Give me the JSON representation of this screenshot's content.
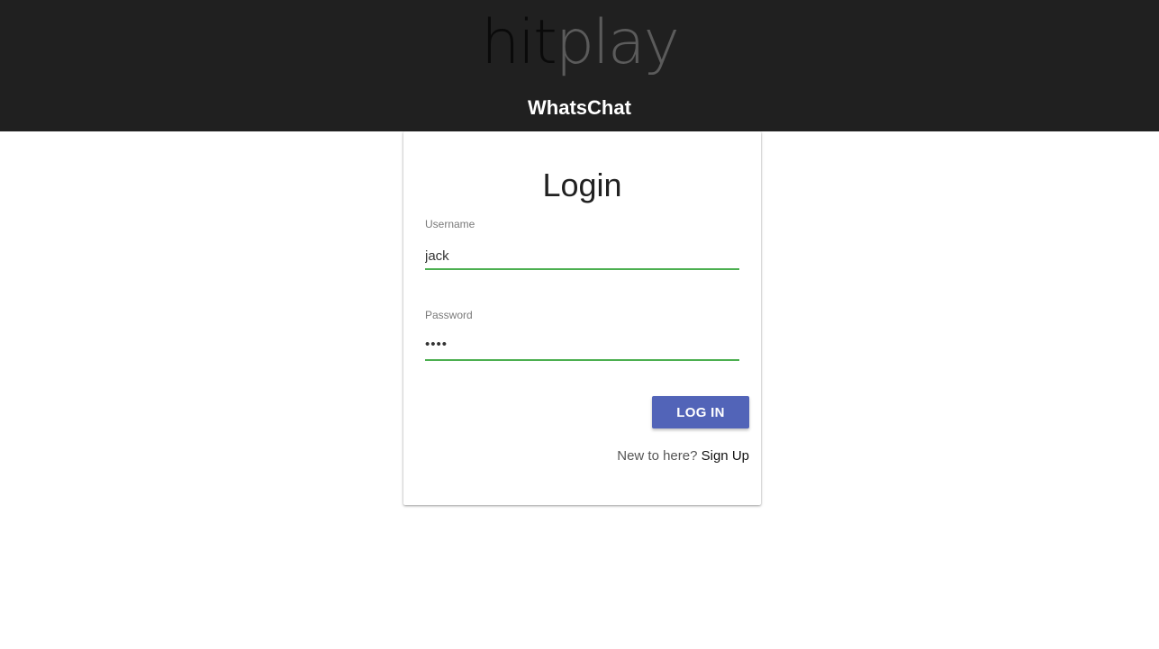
{
  "header": {
    "logo_part1": "hit",
    "logo_part2": "play",
    "app_name": "WhatsChat"
  },
  "login": {
    "title": "Login",
    "username": {
      "label": "Username",
      "value": "jack"
    },
    "password": {
      "label": "Password",
      "masked_value": "••••"
    },
    "submit_label": "LOG IN",
    "signup_prompt": "New to here?",
    "signup_link": "Sign Up"
  },
  "colors": {
    "header_bg": "#202020",
    "input_underline": "#4caf50",
    "button_bg": "#5264b8"
  }
}
